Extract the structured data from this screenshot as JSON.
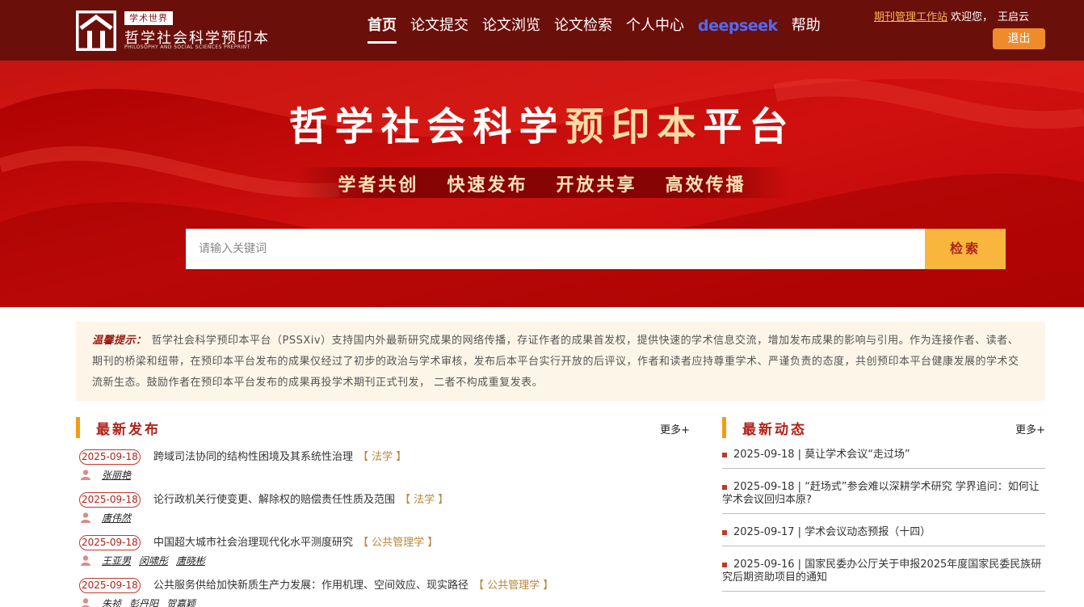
{
  "header": {
    "logo_tag": "学术世界",
    "logo_title": "哲学社会科学预印本",
    "logo_subtitle": "PHILOSOPHY AND SOCIAL SCIENCES PREPRINT",
    "nav": [
      {
        "label": "首页",
        "active": true
      },
      {
        "label": "论文提交"
      },
      {
        "label": "论文浏览"
      },
      {
        "label": "论文检索"
      },
      {
        "label": "个人中心"
      },
      {
        "label": "deepseek",
        "brand": true
      },
      {
        "label": "帮助"
      }
    ],
    "manage_link": "期刊管理工作站",
    "welcome": "欢迎您，",
    "username": "王启云",
    "logout": "退出"
  },
  "banner": {
    "title_white": "哲学社会科学",
    "title_gold": "预印本",
    "title_end": "平台",
    "slogans": [
      "学者共创",
      "快速发布",
      "开放共享",
      "高效传播"
    ],
    "search_placeholder": "请输入关键词",
    "search_button": "检索"
  },
  "notice": {
    "label": "温馨提示：",
    "text": "哲学社会科学预印本平台（PSSXiv）支持国内外最新研究成果的网络传播，存证作者的成果首发权，提供快速的学术信息交流，增加发布成果的影响与引用。作为连接作者、读者、期刊的桥梁和纽带，在预印本平台发布的成果仅经过了初步的政治与学术审核，发布后本平台实行开放的后评议，作者和读者应持尊重学术、严谨负责的态度，共创预印本平台健康发展的学术交流新生态。鼓励作者在预印本平台发布的成果再投学术期刊正式刊发， 二者不构成重复发表。"
  },
  "latest": {
    "title": "最新发布",
    "more": "更多+",
    "items": [
      {
        "date": "2025-09-18",
        "title": "跨域司法协同的结构性困境及其系统性治理",
        "category": "【 法学 】",
        "authors": [
          "张丽艳"
        ]
      },
      {
        "date": "2025-09-18",
        "title": "论行政机关行使变更、解除权的赔偿责任性质及范围",
        "category": "【 法学 】",
        "authors": [
          "唐伟然"
        ]
      },
      {
        "date": "2025-09-18",
        "title": "中国超大城市社会治理现代化水平测度研究",
        "category": "【 公共管理学 】",
        "authors": [
          "王亚男",
          "闵啸彤",
          "唐晓彬"
        ]
      },
      {
        "date": "2025-09-18",
        "title": "公共服务供给加快新质生产力发展：作用机理、空间效应、现实路径",
        "category": "【 公共管理学 】",
        "authors": [
          "朱祯",
          "彭丹阳",
          "贺嘉颖"
        ]
      }
    ]
  },
  "news": {
    "title": "最新动态",
    "more": "更多+",
    "items": [
      {
        "text": "2025-09-18 |   莫让学术会议“走过场”"
      },
      {
        "text": "2025-09-18 |  “赶场式”参会难以深耕学术研究 学界追问：如何让学术会议回归本原?"
      },
      {
        "text": "2025-09-17 |   学术会议动态预报（十四）"
      },
      {
        "text": "2025-09-16 |   国家民委办公厅关于申报2025年度国家民委民族研究后期资助项目的通知"
      }
    ]
  },
  "colors": {
    "header_bg": "#6b0f0a",
    "banner_red": "#c40a0a",
    "accent_orange": "#f39c12",
    "search_button": "#f8b73c",
    "logout_button": "#f08b2c",
    "deepseek_blue": "#4d6bfe"
  },
  "icons": {
    "logo": "building-logo-icon",
    "author": "person-icon",
    "news_bullet": "square-bullet-icon"
  }
}
